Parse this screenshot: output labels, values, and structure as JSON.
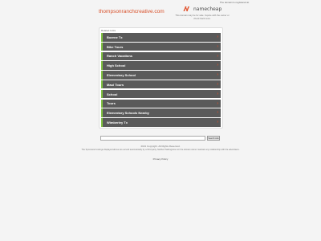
{
  "header": {
    "top_note": "The domain is registered at",
    "domain_title": "thompsonranchcreative.com",
    "brand_name": "namecheap",
    "brand_sub": "This domain may be for sale. Inquire with the owner or check back soon."
  },
  "panel": {
    "heading": "Related Links",
    "items": [
      {
        "label": "Boerne Tx"
      },
      {
        "label": "Bike Tours"
      },
      {
        "label": "Ranch Vacations"
      },
      {
        "label": "High School"
      },
      {
        "label": "Elementary School"
      },
      {
        "label": "Maui Tours"
      },
      {
        "label": "School"
      },
      {
        "label": "Tours"
      },
      {
        "label": "Elementary Schools Nearby"
      },
      {
        "label": "Wimberley Tx"
      }
    ],
    "arrow_glyph": "›"
  },
  "search": {
    "placeholder": "",
    "button_label": "Search Ads"
  },
  "footer": {
    "copyright": "2021 Copyright. All Rights Reserved.",
    "disclaimer": "The Sponsored Listings displayed above are served automatically by a third party. Neither Parkingcrew nor the domain owner maintain any relationship with the advertisers.",
    "privacy": "Privacy Policy"
  },
  "colors": {
    "accent": "#e0502a",
    "row_bg": "#5a5a5a",
    "row_bar": "#7fc241"
  }
}
